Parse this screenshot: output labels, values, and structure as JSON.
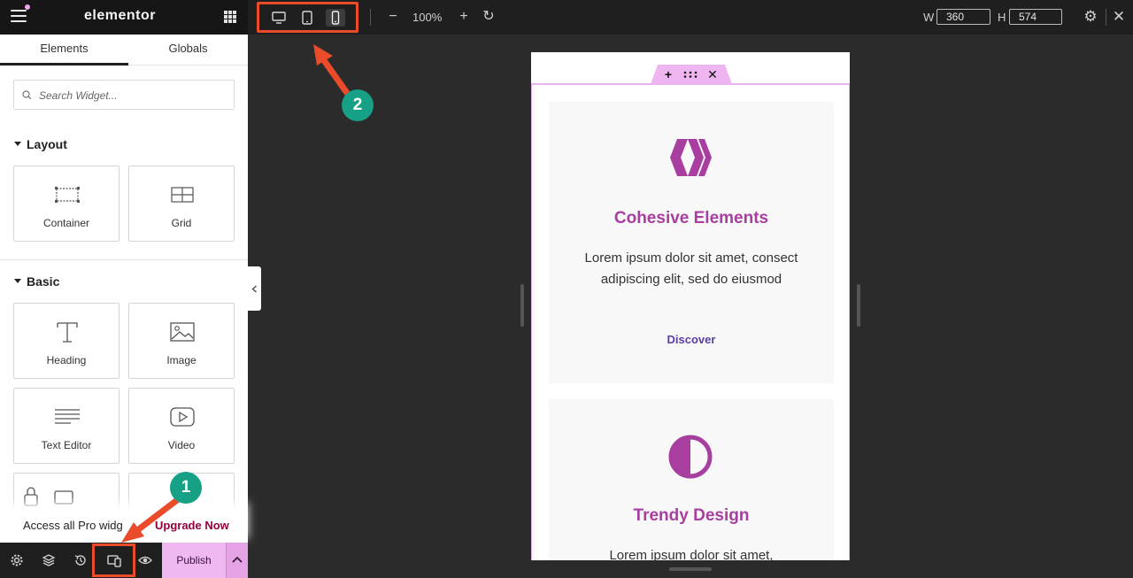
{
  "topbar": {
    "logo": "elementor",
    "zoom": "100%",
    "width_label": "W",
    "width_value": "360",
    "height_label": "H",
    "height_value": "574"
  },
  "panel": {
    "tabs": [
      {
        "label": "Elements"
      },
      {
        "label": "Globals"
      }
    ],
    "search_placeholder": "Search Widget...",
    "layout_title": "Layout",
    "layout_widgets": [
      {
        "label": "Container",
        "icon": "container-icon"
      },
      {
        "label": "Grid",
        "icon": "grid-icon"
      }
    ],
    "basic_title": "Basic",
    "basic_widgets": [
      {
        "label": "Heading",
        "icon": "heading-icon"
      },
      {
        "label": "Image",
        "icon": "image-icon"
      },
      {
        "label": "Text Editor",
        "icon": "text-editor-icon"
      },
      {
        "label": "Video",
        "icon": "video-icon"
      }
    ],
    "pro_text": "Access all Pro widg",
    "pro_link": "Upgrade Now"
  },
  "bottombar": {
    "publish_label": "Publish"
  },
  "canvas": {
    "cards": [
      {
        "title": "Cohesive Elements",
        "text": "Lorem ipsum dolor sit amet, consect adipiscing elit, sed do eiusmod",
        "link": "Discover",
        "icon": "hive-chevron-icon"
      },
      {
        "title": "Trendy Design",
        "text": "Lorem ipsum dolor sit amet,",
        "icon": "half-circle-icon"
      }
    ]
  },
  "annotations": {
    "badge_1": "1",
    "badge_2": "2",
    "accent_color": "#ea4b2a",
    "badge_color": "#16a085"
  },
  "colors": {
    "brand_title": "#a73ea0",
    "link": "#5a3ea8",
    "publish_bg": "#f0b8f0"
  }
}
